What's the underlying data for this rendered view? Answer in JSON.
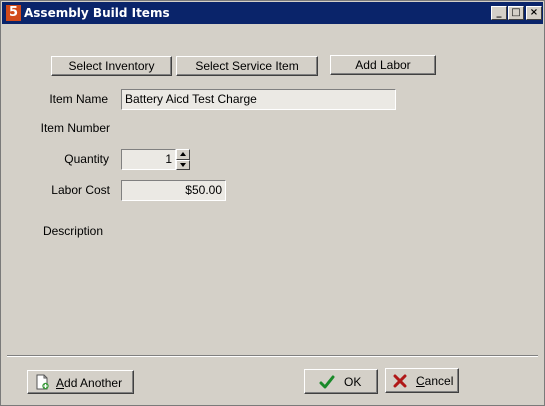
{
  "window": {
    "title": "Assembly Build Items",
    "icon_glyph": "5",
    "controls": {
      "minimize": "_",
      "maximize": "□",
      "close": "×"
    }
  },
  "top_buttons": {
    "select_inventory": "Select Inventory",
    "select_service_item": "Select Service Item",
    "add_labor": "Add Labor"
  },
  "form": {
    "item_name_label": "Item Name",
    "item_name_value": "Battery Aicd Test Charge",
    "item_number_label": "Item Number",
    "quantity_label": "Quantity",
    "quantity_value": "1",
    "labor_cost_label": "Labor Cost",
    "labor_cost_value": "$50.00",
    "description_label": "Description"
  },
  "bottom_buttons": {
    "add_another": {
      "mnemonic": "A",
      "rest": "dd Another",
      "icon": "document-add-icon"
    },
    "ok": {
      "label": "OK",
      "icon": "checkmark-icon"
    },
    "cancel": {
      "mnemonic": "C",
      "rest": "ancel",
      "icon": "x-mark-icon"
    }
  },
  "colors": {
    "titlebar": "#0a246a",
    "face": "#d4d0c8",
    "ok_check": "#1a8a2a",
    "cancel_x": "#b01818"
  }
}
